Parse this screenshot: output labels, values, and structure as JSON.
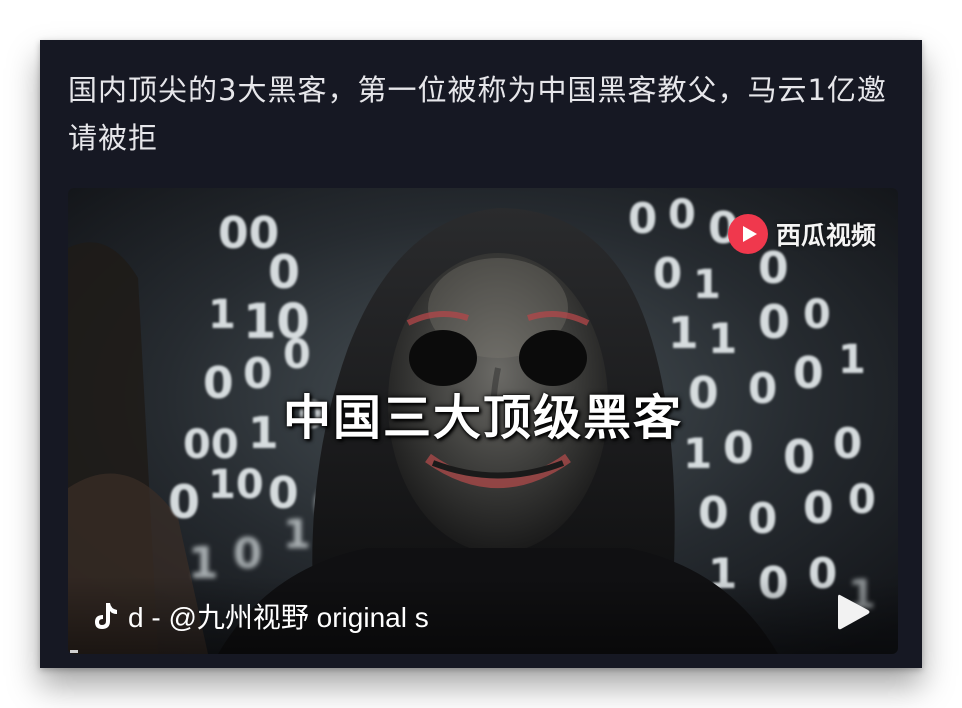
{
  "post": {
    "title": "国内顶尖的3大黑客，第一位被称为中国黑客教父，马云1亿邀请被拒"
  },
  "video": {
    "overlay_title": "中国三大顶级黑客",
    "watermark_text": "西瓜视频",
    "watermark_icon": "xigua-logo-icon",
    "caption": "d - @九州视野   original s",
    "caption_icon": "tiktok-note-icon",
    "play_icon": "play-icon"
  },
  "colors": {
    "card_background": "#161823",
    "title_text": "#e6e6ea",
    "watermark_red": "#f0384d"
  }
}
